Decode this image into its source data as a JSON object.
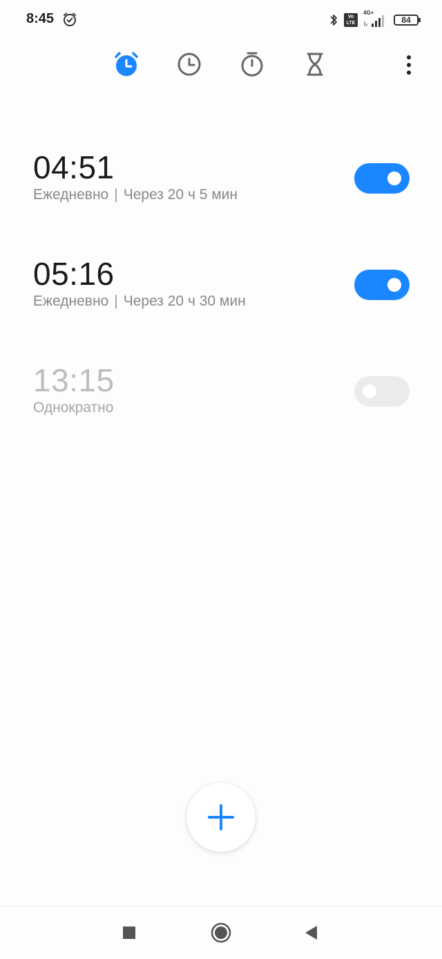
{
  "status_bar": {
    "time": "8:45",
    "network_label": "4G+",
    "volte_label": "Vo LTE",
    "battery": "84"
  },
  "tabs": [
    {
      "name": "alarm",
      "icon": "alarm-clock-icon",
      "active": true
    },
    {
      "name": "world-clock",
      "icon": "clock-icon",
      "active": false
    },
    {
      "name": "stopwatch",
      "icon": "stopwatch-icon",
      "active": false
    },
    {
      "name": "timer",
      "icon": "hourglass-icon",
      "active": false
    }
  ],
  "alarms": [
    {
      "time": "04:51",
      "repeat": "Ежедневно",
      "separator": "|",
      "remaining": "Через 20 ч 5 мин",
      "enabled": true
    },
    {
      "time": "05:16",
      "repeat": "Ежедневно",
      "separator": "|",
      "remaining": "Через 20 ч 30 мин",
      "enabled": true
    },
    {
      "time": "13:15",
      "repeat": "Однократно",
      "enabled": false
    }
  ],
  "colors": {
    "accent": "#1a86ff",
    "toggle_off": "#ebebeb",
    "text_primary": "#1a1a1a",
    "text_secondary": "#888888",
    "text_disabled": "#bdbdbd"
  },
  "nav": [
    "recents-square-icon",
    "home-circle-icon",
    "back-triangle-icon"
  ]
}
